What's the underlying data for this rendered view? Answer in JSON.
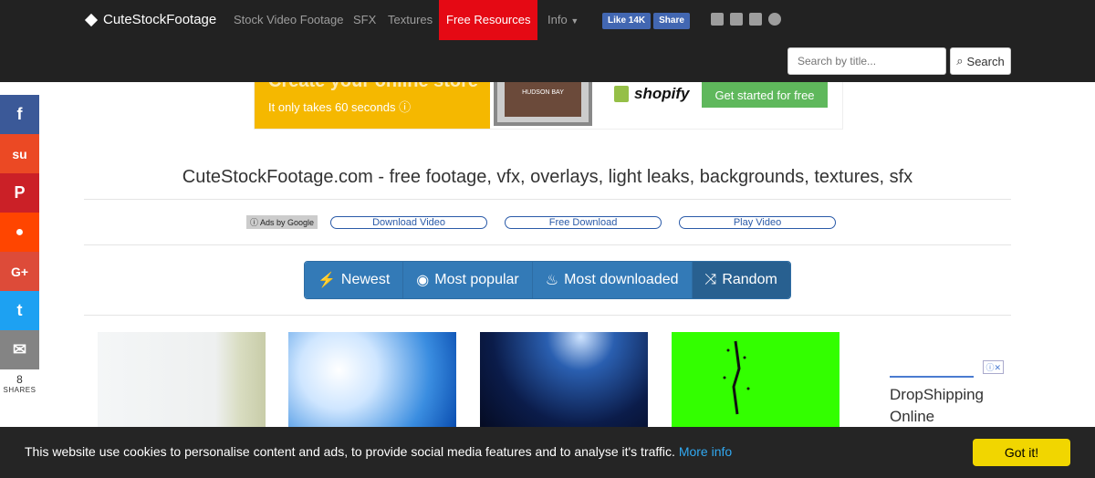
{
  "navbar": {
    "brand": "CuteStockFootage",
    "links": [
      "Stock Video Footage",
      "SFX",
      "Textures",
      "Free Resources",
      "Info"
    ],
    "active_link": "Free Resources",
    "fb_like": "Like 14K",
    "fb_share": "Share",
    "social_icons": [
      "facebook-icon",
      "youtube-icon",
      "twitter-icon",
      "pinterest-icon"
    ],
    "search_placeholder": "Search by title...",
    "search_button": "Search"
  },
  "ad_banner": {
    "headline": "Create your online store",
    "subline": "It only takes 60 seconds ⓘ",
    "laptop_text": "HUDSON BAY",
    "brand": "shopify",
    "cta": "Get started for free"
  },
  "share_bar": {
    "buttons": [
      {
        "name": "facebook",
        "glyph": "f",
        "color": "#3b5998"
      },
      {
        "name": "stumbleupon",
        "glyph": "ʂ",
        "color": "#eb4924"
      },
      {
        "name": "pinterest",
        "glyph": "P",
        "color": "#cb2027"
      },
      {
        "name": "reddit",
        "glyph": "👽",
        "color": "#ff4500"
      },
      {
        "name": "google-plus",
        "glyph": "G+",
        "color": "#dd4b39"
      },
      {
        "name": "twitter",
        "glyph": "🐦",
        "color": "#1da1f2"
      },
      {
        "name": "email",
        "glyph": "✉",
        "color": "#848484"
      }
    ],
    "count": "8",
    "label": "SHARES"
  },
  "main": {
    "title": "CuteStockFootage.com - free footage, vfx, overlays, light leaks, backgrounds, textures, sfx",
    "ads_by": "ⓘ Ads by Google",
    "ad_links": [
      "Download Video",
      "Free Download",
      "Play Video"
    ],
    "sort_buttons": [
      {
        "label": "Newest",
        "icon": "⚡"
      },
      {
        "label": "Most popular",
        "icon": "👁"
      },
      {
        "label": "Most downloaded",
        "icon": "🔥"
      },
      {
        "label": "Random",
        "icon": "⤨"
      }
    ]
  },
  "thumbnails": [
    {
      "name": "light-leak-white",
      "gradient": "linear-gradient(90deg,#f4f6f7 0%,#eef0f0 70%,#d8dcc0 85%,#c8cca8 100%)"
    },
    {
      "name": "light-flare-blue",
      "gradient": "radial-gradient(circle at 30% 40%,#ffffff 0%,#cfe6ff 30%,#3a8de0 70%,#0a4db0 100%)"
    },
    {
      "name": "blue-wave-grid",
      "gradient": "radial-gradient(circle at 60% 5%,#cfe4ff 0%,#2a5fb0 25%,#0b1c4a 65%,#050b22 100%)"
    },
    {
      "name": "green-screen-particles",
      "gradient": "#33ff00"
    }
  ],
  "side_ad": {
    "close": "ⓘ✕",
    "text": "DropShipping Online"
  },
  "cookie": {
    "message": "This website use cookies to personalise content and ads, to provide social media features and to analyse it's traffic.",
    "link": "More info",
    "button": "Got it!"
  }
}
